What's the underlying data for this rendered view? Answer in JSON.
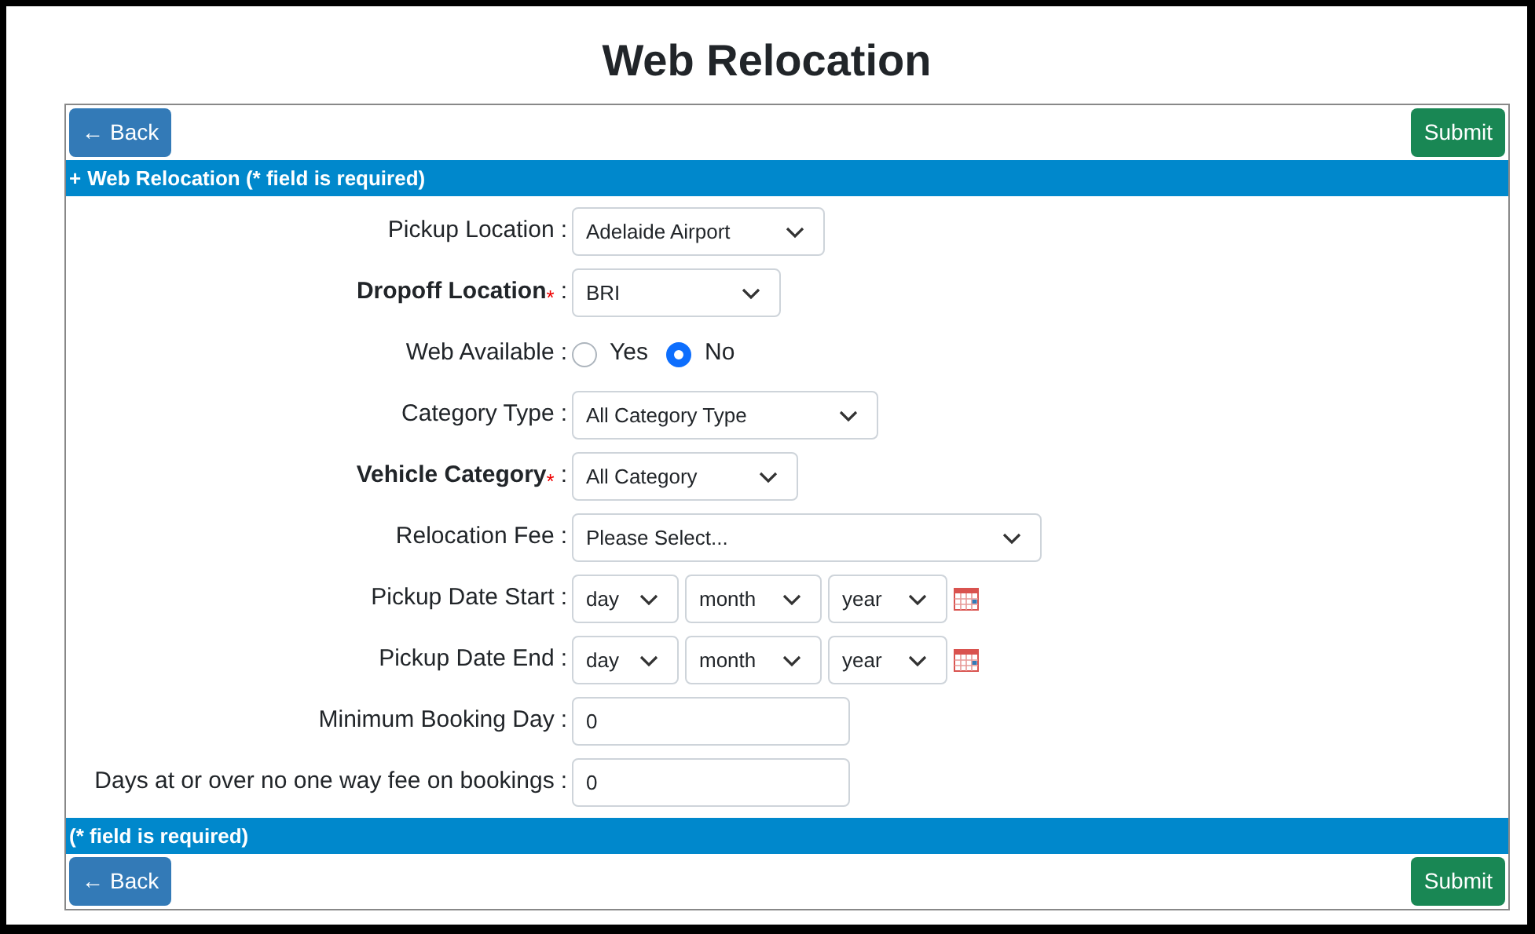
{
  "title": "Web Relocation",
  "top_buttons": {
    "back": {
      "icon": "←",
      "label": "Back"
    },
    "submit": "Submit"
  },
  "header_bar": {
    "icon": "+",
    "text": "Web Relocation (* field is required)"
  },
  "rows": [
    {
      "label": "Pickup Location",
      "required": false,
      "colon": ":",
      "kind": "select",
      "value": "Adelaide Airport"
    },
    {
      "label": "Dropoff Location",
      "required": true,
      "mark": "*",
      "colon": ":",
      "kind": "select",
      "value": "BRI"
    },
    {
      "label": "Web Available",
      "required": false,
      "colon": ":",
      "kind": "radio",
      "options": [
        {
          "label": "Yes",
          "selected": false
        },
        {
          "label": "No",
          "selected": true
        }
      ]
    },
    {
      "label": "Category Type",
      "required": false,
      "colon": ":",
      "kind": "select",
      "value": "All Category Type"
    },
    {
      "label": "Vehicle Category",
      "required": true,
      "mark": "*",
      "colon": ":",
      "kind": "select",
      "value": "All Category"
    },
    {
      "label": "Relocation Fee",
      "required": false,
      "colon": ":",
      "kind": "select",
      "value": "Please Select..."
    },
    {
      "label": "Pickup Date Start",
      "required": false,
      "colon": ":",
      "kind": "date",
      "parts": [
        "day",
        "month",
        "year"
      ]
    },
    {
      "label": "Pickup Date End",
      "required": false,
      "colon": ":",
      "kind": "date",
      "parts": [
        "day",
        "month",
        "year"
      ]
    },
    {
      "label": "Minimum Booking Day",
      "required": false,
      "colon": ":",
      "kind": "text",
      "value": "0"
    },
    {
      "label": "Days at or over no one way fee on bookings",
      "required": false,
      "colon": ":",
      "kind": "text",
      "value": "0"
    }
  ],
  "footer_bar": "(* field is required)",
  "bottom_buttons": {
    "back": {
      "icon": "←",
      "label": "Back"
    },
    "submit": "Submit"
  }
}
